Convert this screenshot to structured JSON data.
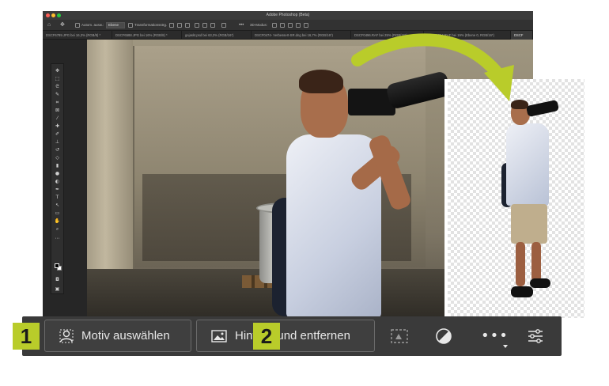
{
  "window": {
    "title": "Adobe Photoshop (Beta)"
  },
  "options_bar": {
    "auto_select": "Autom. ausw.:",
    "auto_select_value": "Ebene",
    "transform_controls": "Transformationsstrg.",
    "mode_3d": "3D-Modus:"
  },
  "tabs": [
    {
      "label": "DSCF6789.JPG bei 16,3% (RGB/8) *"
    },
    {
      "label": "DSCF6588.JPG bei 16% (RGB/8) *"
    },
    {
      "label": "gejaskt.psd bei 63,3% (RGB/16*)"
    },
    {
      "label": "DSCF0474- Verbessert-SR.dng bei 16,7% (RGB/16*)"
    },
    {
      "label": "DSCF0496.RAF bei 25% (RGB/16*)"
    },
    {
      "label": "DSCF2064.RAF bei 19% (Ebene 0, RGB/16*)"
    },
    {
      "label": "DSCF"
    }
  ],
  "taskbar": {
    "select_subject_label": "Motiv auswählen",
    "remove_background_label": "Hintergrund entfernen",
    "badge_1": "1",
    "badge_2": "2"
  },
  "colors": {
    "accent": "#b9cc2a",
    "taskbar_bg": "#3a3a3a",
    "button_border": "#6a6a6a"
  },
  "icons": [
    "home-icon",
    "move-tool-icon",
    "person-select-icon",
    "image-icon",
    "mask-icon",
    "adjust-circle-icon",
    "more-icon",
    "sliders-icon"
  ]
}
